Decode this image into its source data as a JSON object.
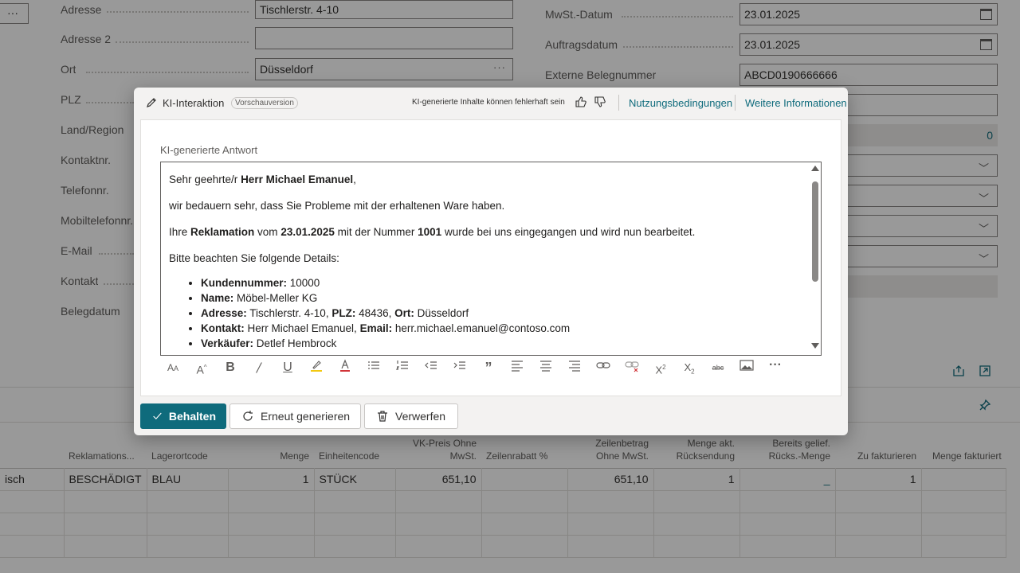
{
  "background": {
    "left_labels": [
      "Adresse",
      "Adresse 2",
      "Ort",
      "PLZ",
      "Land/Region",
      "Kontaktnr.",
      "Telefonnr.",
      "Mobiltelefonnr.",
      "E-Mail",
      "Kontakt",
      "Belegdatum"
    ],
    "left_values": {
      "adresse": "Tischlerstr. 4-10",
      "adresse2": "",
      "ort": "Düsseldorf"
    },
    "right_labels": [
      "MwSt.-Datum",
      "Auftragsdatum",
      "Externe Belegnummer"
    ],
    "right_values": {
      "mwst_datum": "23.01.2025",
      "auftragsdatum": "23.01.2025",
      "externe_belegnummer": "ABCD0190666666",
      "number_field": "0"
    },
    "ellipsis": "···"
  },
  "grid": {
    "headers": [
      "Reklamations...",
      "Lagerortcode",
      "Menge",
      "Einheitencode",
      "VK-Preis Ohne MwSt.",
      "Zeilenrabatt %",
      "Zeilenbetrag Ohne MwSt.",
      "Menge akt. Rücksendung",
      "Bereits gelief. Rücks.-Menge",
      "Zu fakturieren",
      "Menge fakturiert"
    ],
    "row": {
      "partial": "isch",
      "reklamation": "BESCHÄDIGT",
      "lagerort": "BLAU",
      "menge": "1",
      "einheit": "STÜCK",
      "vk_preis": "651,10",
      "rabatt": "",
      "zeilenbetrag": "651,10",
      "menge_rueck": "1",
      "bereits": "_",
      "zu_fakturieren": "1",
      "fakturiert": ""
    }
  },
  "dialog": {
    "title": "KI-Interaktion",
    "badge": "Vorschauversion",
    "warning": "KI-generierte Inhalte können fehlerhaft sein",
    "link_terms": "Nutzungsbedingungen",
    "link_more": "Weitere Informationen",
    "panel_label": "KI-generierte Antwort",
    "email": {
      "greeting_pre": "Sehr geehrte/r ",
      "greeting_name": "Herr Michael Emanuel",
      "greeting_post": ",",
      "line1": "wir bedauern sehr, dass Sie Probleme mit der erhaltenen Ware haben.",
      "line2_a": "Ihre ",
      "line2_b": "Reklamation",
      "line2_c": " vom ",
      "line2_d": "23.01.2025",
      "line2_e": " mit der Nummer ",
      "line2_f": "1001",
      "line2_g": " wurde bei uns eingegangen und wird nun bearbeitet.",
      "line3": "Bitte beachten Sie folgende Details:",
      "items": {
        "kundennr_label": "Kundennummer:",
        "kundennr": " 10000",
        "name_label": "Name:",
        "name": " Möbel-Meller KG",
        "adresse_label": "Adresse:",
        "adresse": " Tischlerstr. 4-10, ",
        "plz_label": "PLZ:",
        "plz": " 48436, ",
        "ort_label": "Ort:",
        "ort": " Düsseldorf",
        "kontakt_label": "Kontakt:",
        "kontakt": " Herr Michael Emanuel, ",
        "email_label": "Email:",
        "email": " herr.michael.emanuel@contoso.com",
        "verkaeufer_label": "Verkäufer:",
        "verkaeufer": " Detlef Hembrock"
      }
    },
    "buttons": {
      "keep": "Behalten",
      "regenerate": "Erneut generieren",
      "discard": "Verwerfen"
    }
  },
  "colors": {
    "accent": "#0f6b7c",
    "overlay": "rgba(0,0,0,0.40)"
  }
}
